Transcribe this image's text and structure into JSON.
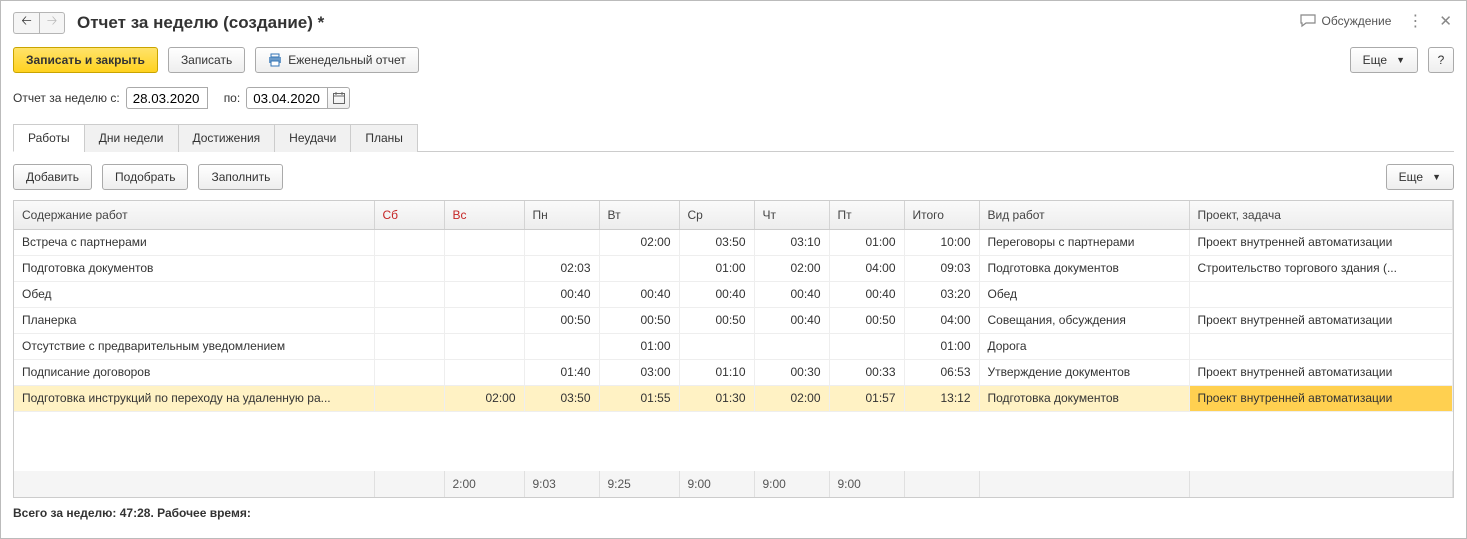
{
  "header": {
    "title": "Отчет за неделю (создание) *",
    "discuss_label": "Обсуждение"
  },
  "toolbar": {
    "save_close": "Записать и закрыть",
    "save": "Записать",
    "weekly_report": "Еженедельный отчет",
    "more": "Еще",
    "help": "?"
  },
  "dates": {
    "label_from": "Отчет за неделю с:",
    "from": "28.03.2020",
    "label_to": "по:",
    "to": "03.04.2020"
  },
  "tabs": [
    "Работы",
    "Дни недели",
    "Достижения",
    "Неудачи",
    "Планы"
  ],
  "subtoolbar": {
    "add": "Добавить",
    "pick": "Подобрать",
    "fill": "Заполнить",
    "more": "Еще"
  },
  "table": {
    "columns": [
      "Содержание работ",
      "Сб",
      "Вс",
      "Пн",
      "Вт",
      "Ср",
      "Чт",
      "Пт",
      "Итого",
      "Вид работ",
      "Проект, задача"
    ],
    "rows": [
      {
        "content": "Встреча с партнерами",
        "sb": "",
        "vs": "",
        "pn": "",
        "vt": "02:00",
        "sr": "03:50",
        "ch": "03:10",
        "pt": "01:00",
        "total": "10:00",
        "type": "Переговоры с партнерами",
        "project": "Проект внутренней автоматизации"
      },
      {
        "content": "Подготовка документов",
        "sb": "",
        "vs": "",
        "pn": "02:03",
        "vt": "",
        "sr": "01:00",
        "ch": "02:00",
        "pt": "04:00",
        "total": "09:03",
        "type": "Подготовка документов",
        "project": "Строительство торгового здания (..."
      },
      {
        "content": "Обед",
        "sb": "",
        "vs": "",
        "pn": "00:40",
        "vt": "00:40",
        "sr": "00:40",
        "ch": "00:40",
        "pt": "00:40",
        "total": "03:20",
        "type": "Обед",
        "project": ""
      },
      {
        "content": "Планерка",
        "sb": "",
        "vs": "",
        "pn": "00:50",
        "vt": "00:50",
        "sr": "00:50",
        "ch": "00:40",
        "pt": "00:50",
        "total": "04:00",
        "type": "Совещания, обсуждения",
        "project": "Проект внутренней автоматизации"
      },
      {
        "content": "Отсутствие с предварительным уведомлением",
        "sb": "",
        "vs": "",
        "pn": "",
        "vt": "01:00",
        "sr": "",
        "ch": "",
        "pt": "",
        "total": "01:00",
        "type": "Дорога",
        "project": ""
      },
      {
        "content": "Подписание договоров",
        "sb": "",
        "vs": "",
        "pn": "01:40",
        "vt": "03:00",
        "sr": "01:10",
        "ch": "00:30",
        "pt": "00:33",
        "total": "06:53",
        "type": "Утверждение документов",
        "project": "Проект внутренней автоматизации"
      },
      {
        "content": "Подготовка инструкций по переходу на удаленную ра...",
        "sb": "",
        "vs": "02:00",
        "pn": "03:50",
        "vt": "01:55",
        "sr": "01:30",
        "ch": "02:00",
        "pt": "01:57",
        "total": "13:12",
        "type": "Подготовка документов",
        "project": "Проект внутренней автоматизации",
        "selected": true
      }
    ],
    "footer": [
      "",
      "",
      "2:00",
      "9:03",
      "9:25",
      "9:00",
      "9:00",
      "9:00",
      "",
      "",
      ""
    ]
  },
  "summary": "Всего за неделю: 47:28. Рабочее время:"
}
